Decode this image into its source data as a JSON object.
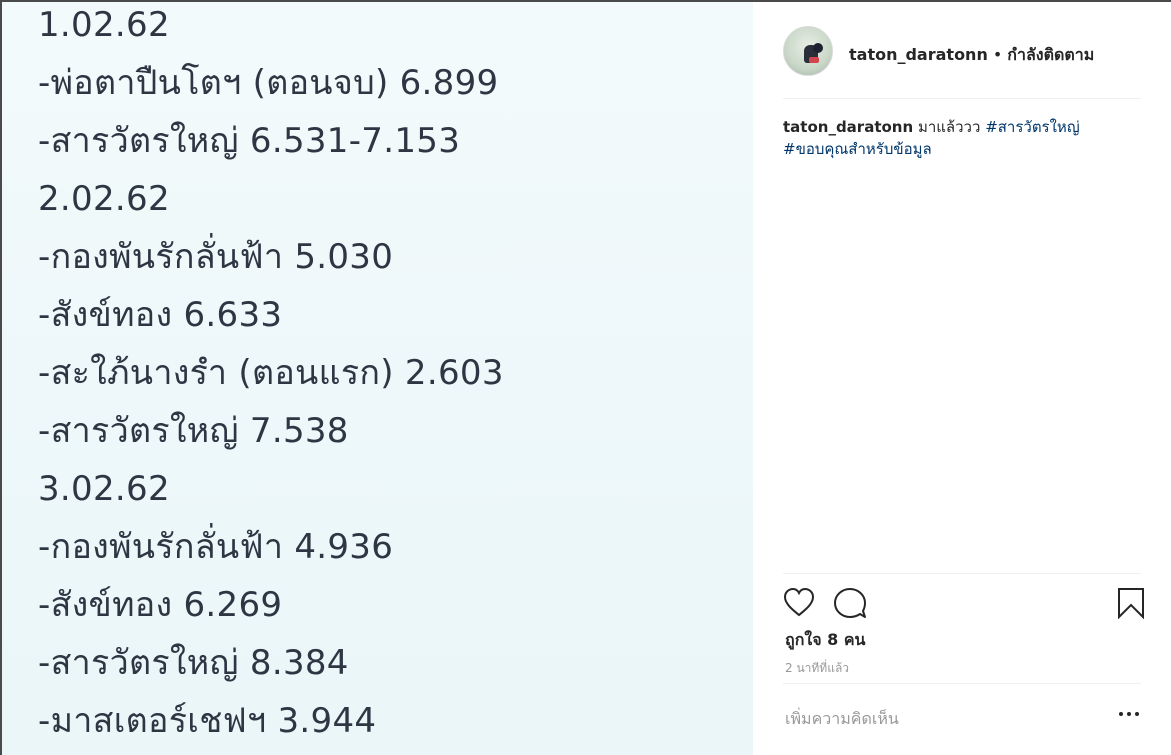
{
  "post": {
    "note_lines": [
      "1.02.62",
      "-พ่อตาปืนโตฯ (ตอนจบ) 6.899",
      "-สารวัตรใหญ่  6.531-7.153",
      "2.02.62",
      "-กองพันรักลั่นฟ้า  5.030",
      "-สังข์ทอง  6.633",
      "-สะใภ้นางรำ (ตอนแรก) 2.603",
      "-สารวัตรใหญ่  7.538",
      "3.02.62",
      "-กองพันรักลั่นฟ้า   4.936",
      "-สังข์ทอง  6.269",
      "-สารวัตรใหญ่ 8.384",
      "-มาสเตอร์เชฟฯ 3.944"
    ]
  },
  "header": {
    "username": "taton_daratonn",
    "separator": "•",
    "follow_status": "กำลังติดตาม"
  },
  "caption": {
    "username": "taton_daratonn",
    "text": "มาแล้ววว",
    "hashtag1": "#สารวัตรใหญ่",
    "hashtag2": "#ขอบคุณสำหรับข้อมูล"
  },
  "actions": {
    "icons": [
      "heart-icon",
      "comment-icon",
      "bookmark-icon",
      "more-icon"
    ]
  },
  "likes": "ถูกใจ 8 คน",
  "time_ago": "2 นาทีที่แล้ว",
  "comment": {
    "placeholder": "เพิ่มความคิดเห็น"
  }
}
